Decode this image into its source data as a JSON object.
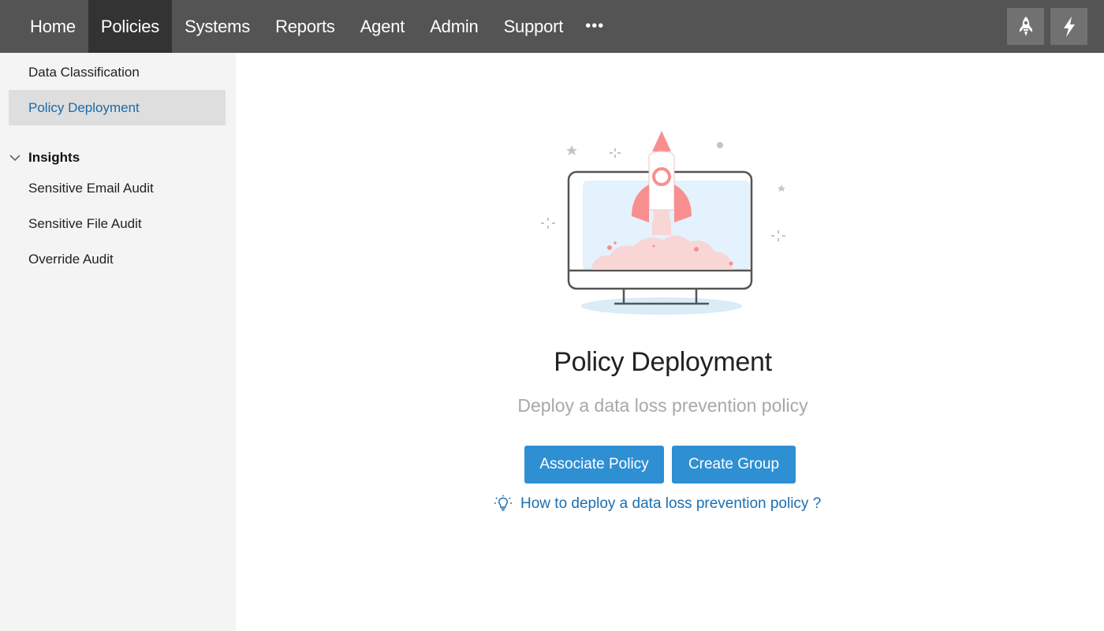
{
  "topnav": {
    "items": [
      {
        "label": "Home",
        "active": false
      },
      {
        "label": "Policies",
        "active": true
      },
      {
        "label": "Systems",
        "active": false
      },
      {
        "label": "Reports",
        "active": false
      },
      {
        "label": "Agent",
        "active": false
      },
      {
        "label": "Admin",
        "active": false
      },
      {
        "label": "Support",
        "active": false
      }
    ],
    "more_label": "•••",
    "right_icons": [
      "rocket-icon",
      "lightning-icon"
    ]
  },
  "sidebar": {
    "items": [
      {
        "label": "Data Classification"
      },
      {
        "label": "Policy Deployment",
        "active": true
      }
    ],
    "group": {
      "label": "Insights",
      "items": [
        {
          "label": "Sensitive Email Audit"
        },
        {
          "label": "Sensitive File Audit"
        },
        {
          "label": "Override Audit"
        }
      ]
    }
  },
  "main": {
    "title": "Policy Deployment",
    "subtitle": "Deploy a data loss prevention policy",
    "associate_button": "Associate Policy",
    "create_group_button": "Create Group",
    "help_link": "How to deploy a data loss prevention policy ?"
  },
  "colors": {
    "nav_bg": "#545454",
    "nav_active": "#333333",
    "primary_button": "#2f8fd3",
    "link": "#1d6fb0",
    "sidebar_bg": "#f4f4f4",
    "rocket": "#f88f8f"
  }
}
